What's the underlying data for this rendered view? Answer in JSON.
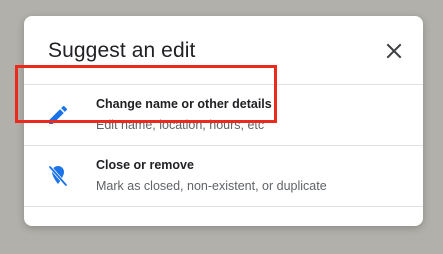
{
  "dialog": {
    "title": "Suggest an edit",
    "close_icon": "close-icon",
    "options": [
      {
        "label": "Change name or other details",
        "description": "Edit name, location, hours, etc",
        "icon": "pencil-icon"
      },
      {
        "label": "Close or remove",
        "description": "Mark as closed, non-existent, or duplicate",
        "icon": "location-off-icon"
      }
    ]
  },
  "colors": {
    "accent_blue": "#1a73e8",
    "highlight_red": "#ea2a1c",
    "backdrop": "#b2b0aa"
  }
}
